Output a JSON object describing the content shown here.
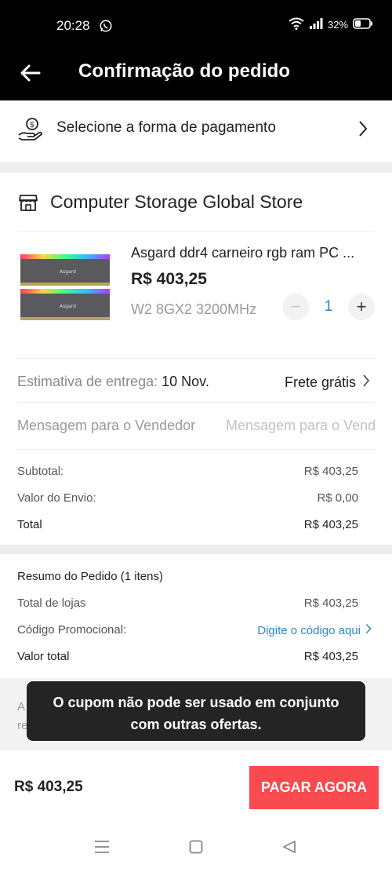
{
  "status_bar": {
    "time": "20:28",
    "battery": "32%"
  },
  "header": {
    "title": "Confirmação do pedido"
  },
  "payment": {
    "label": "Selecione a forma de pagamento"
  },
  "store": {
    "name": "Computer Storage Global Store",
    "product": {
      "name": "Asgard ddr4 carneiro rgb ram PC ...",
      "price": "R$ 403,25",
      "variant": "W2 8GX2 3200MHz",
      "quantity": "1",
      "image_brand": "Asgard"
    },
    "shipping": {
      "estimate_label": "Estimativa de entrega:",
      "estimate_value": "10 Nov.",
      "shipping_label": "Frete grátis"
    },
    "message": {
      "label": "Mensagem para o Vendedor",
      "placeholder": "Mensagem para o Vendedor"
    },
    "summary": [
      {
        "label": "Subtotal:",
        "value": "R$ 403,25"
      },
      {
        "label": "Valor do Envio:",
        "value": "R$ 0,00"
      },
      {
        "label": "Total",
        "value": "R$ 403,25"
      }
    ]
  },
  "resumo": {
    "title": "Resumo do Pedido (1 itens)",
    "rows": [
      {
        "label": "Total de lojas",
        "value": "R$ 403,25"
      },
      {
        "label": "Código Promocional:",
        "value": "Digite o código aqui"
      },
      {
        "label": "Valor total",
        "value": "R$ 403,25"
      }
    ]
  },
  "behind_toast": {
    "line1": "A",
    "line2": "re"
  },
  "toast": {
    "line1": "O cupom não pode ser usado em conjunto",
    "line2": "com outras ofertas."
  },
  "footer": {
    "total": "R$ 403,25",
    "pay_button": "PAGAR AGORA"
  },
  "colors": {
    "accent_blue": "#2c87c8",
    "pay_red": "#f84a4f",
    "header_black": "#000000"
  },
  "icons": [
    "whatsapp-icon",
    "wifi-icon",
    "signal-icon",
    "battery-icon",
    "back-arrow-icon",
    "payment-hand-icon",
    "chevron-right-icon",
    "store-icon",
    "minus-icon",
    "plus-icon",
    "menu-nav-icon",
    "home-nav-icon",
    "back-nav-icon"
  ]
}
